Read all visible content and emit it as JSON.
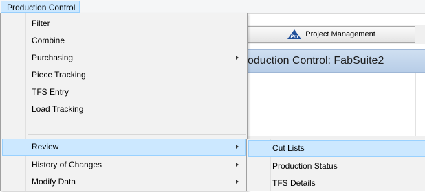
{
  "menubar": {
    "active_menu": "Production Control"
  },
  "background": {
    "pm_button_label": "Project Management",
    "pm_icon_text": "Pm",
    "title": "oduction Control: FabSuite2"
  },
  "dropdown": {
    "items": [
      {
        "label": "Filter",
        "has_submenu": false
      },
      {
        "label": "Combine",
        "has_submenu": false
      },
      {
        "label": "Purchasing",
        "has_submenu": true
      },
      {
        "label": "Piece Tracking",
        "has_submenu": false
      },
      {
        "label": "TFS Entry",
        "has_submenu": false
      },
      {
        "label": "Load Tracking",
        "has_submenu": false
      },
      {
        "label": "Review",
        "has_submenu": true,
        "highlighted": true
      },
      {
        "label": "History of Changes",
        "has_submenu": true
      },
      {
        "label": "Modify Data",
        "has_submenu": true
      }
    ]
  },
  "submenu": {
    "items": [
      {
        "label": "Cut Lists",
        "highlighted": true
      },
      {
        "label": "Production Status"
      },
      {
        "label": "TFS Details"
      }
    ]
  },
  "colors": {
    "highlight_fill": "#cce8ff",
    "highlight_border": "#99d1ff",
    "menu_bg": "#f2f2f2",
    "title_bar": "#c3d6ec"
  }
}
